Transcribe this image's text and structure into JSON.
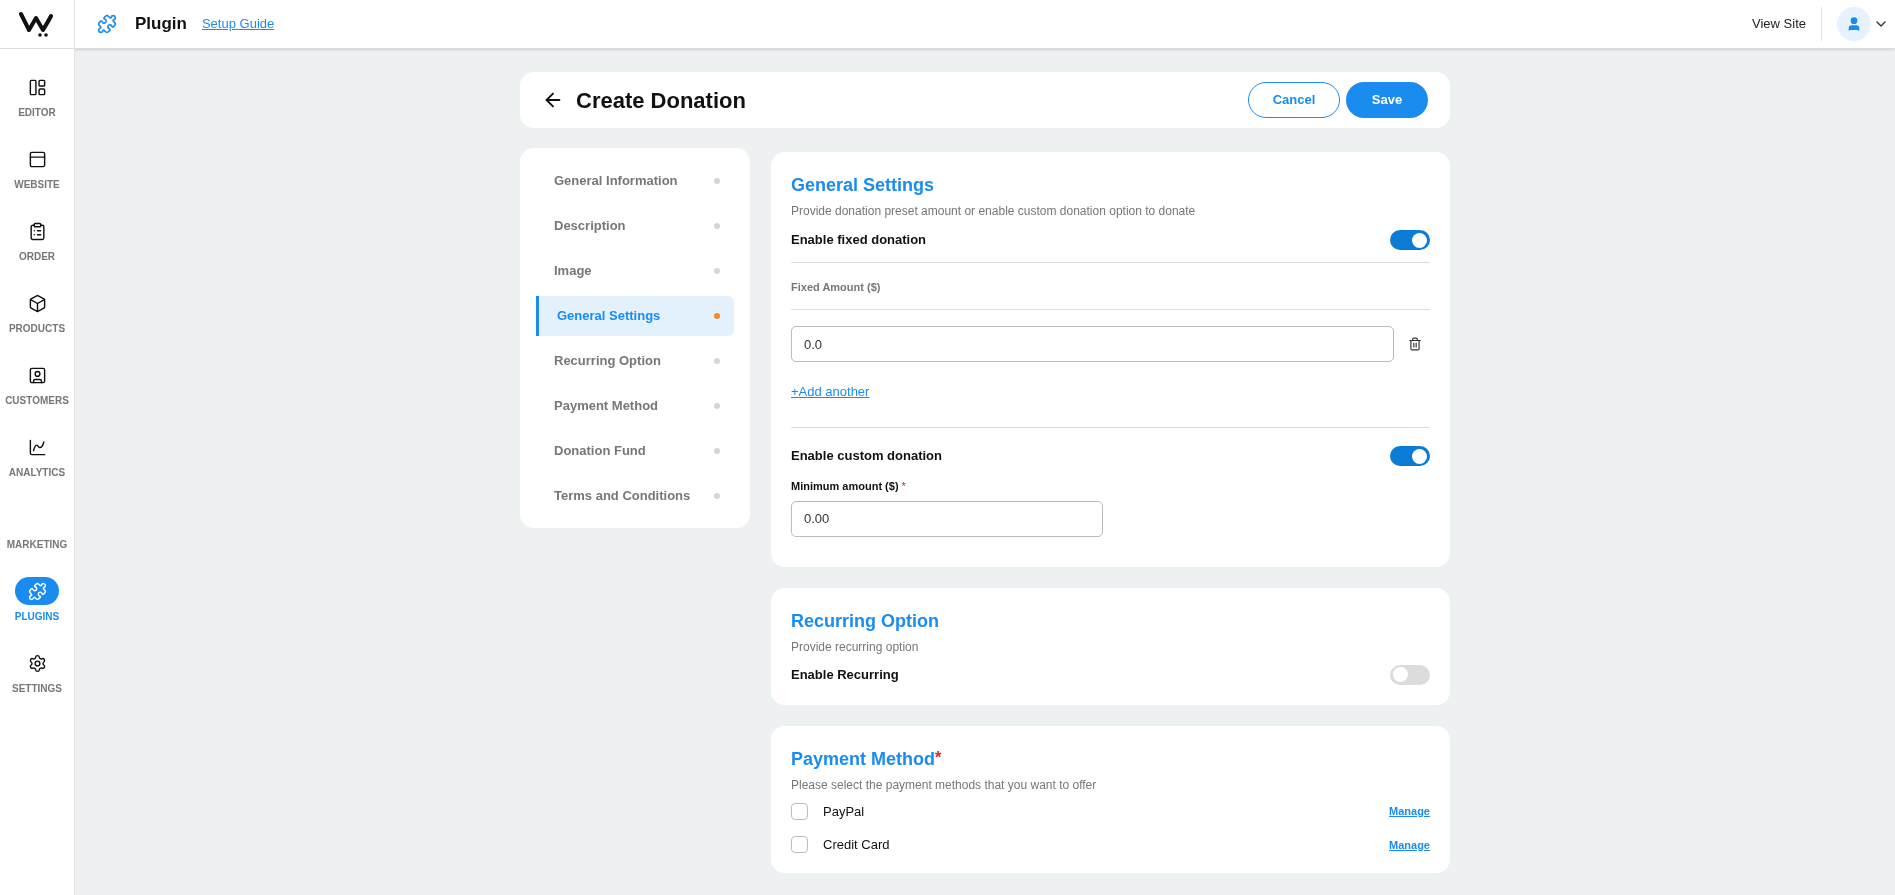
{
  "topbar": {
    "title": "Plugin",
    "guide_link": "Setup Guide",
    "view_site": "View Site"
  },
  "sidebar": {
    "items": [
      {
        "label": "EDITOR",
        "selected": false
      },
      {
        "label": "WEBSITE",
        "selected": false
      },
      {
        "label": "ORDER",
        "selected": false
      },
      {
        "label": "PRODUCTS",
        "selected": false
      },
      {
        "label": "CUSTOMERS",
        "selected": false
      },
      {
        "label": "ANALYTICS",
        "selected": false
      },
      {
        "label": "MARKETING",
        "selected": false
      },
      {
        "label": "PLUGINS",
        "selected": true
      },
      {
        "label": "SETTINGS",
        "selected": false
      }
    ]
  },
  "header": {
    "title": "Create Donation",
    "cancel": "Cancel",
    "save": "Save"
  },
  "sections_nav": [
    {
      "label": "General Information",
      "selected": false
    },
    {
      "label": "Description",
      "selected": false
    },
    {
      "label": "Image",
      "selected": false
    },
    {
      "label": "General Settings",
      "selected": true
    },
    {
      "label": "Recurring Option",
      "selected": false
    },
    {
      "label": "Payment Method",
      "selected": false
    },
    {
      "label": "Donation Fund",
      "selected": false
    },
    {
      "label": "Terms and Conditions",
      "selected": false
    }
  ],
  "general_settings": {
    "title": "General Settings",
    "description": "Provide donation preset amount or enable custom donation option to donate",
    "fixed_toggle": {
      "label": "Enable fixed donation",
      "on": true
    },
    "fixed_amount_label": "Fixed Amount ($)",
    "amounts": [
      {
        "value": "0.0"
      }
    ],
    "add_link": "+Add another",
    "custom_toggle": {
      "label": "Enable custom donation",
      "on": true
    },
    "minimum": {
      "label": "Minimum amount ($)",
      "required_mark": "*",
      "value": "0.00"
    }
  },
  "recurring": {
    "title": "Recurring Option",
    "description": "Provide recurring option",
    "toggle": {
      "label": "Enable Recurring",
      "on": false
    }
  },
  "payment": {
    "title": "Payment Method",
    "required_mark": "*",
    "description": "Please select the payment methods that you want to offer",
    "methods": [
      {
        "label": "PayPal",
        "checked": false,
        "link": "Manage"
      },
      {
        "label": "Credit Card",
        "checked": false,
        "link": "Manage"
      }
    ]
  }
}
